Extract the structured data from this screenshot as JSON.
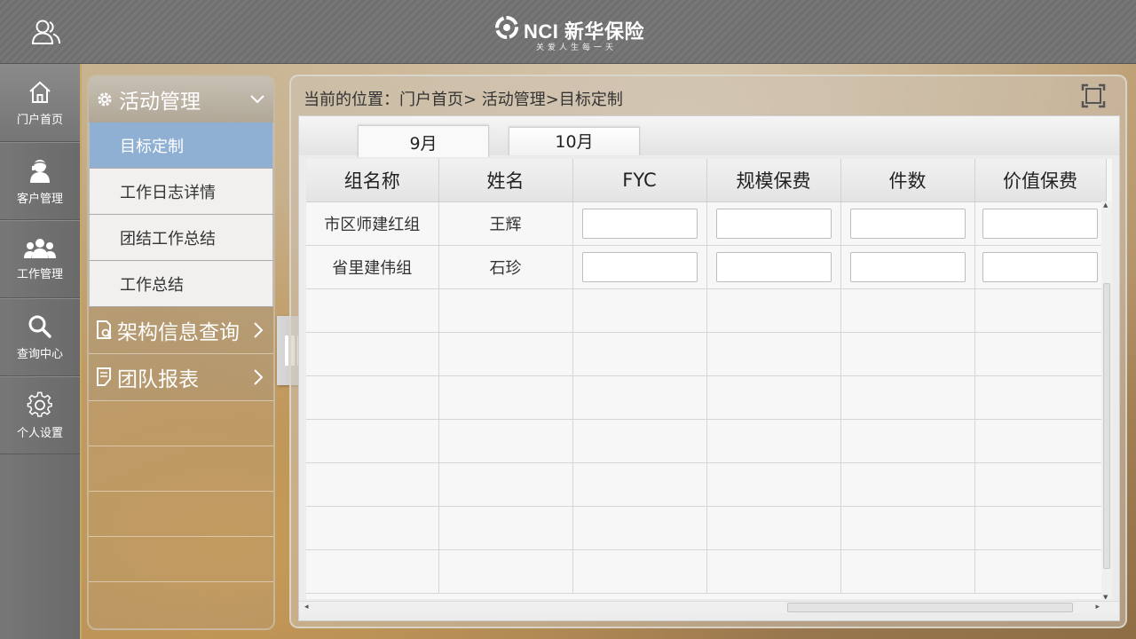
{
  "header": {
    "logo_text": "NCI 新华保险",
    "slogan": "关爱人生每一天"
  },
  "leftnav": {
    "items": [
      {
        "label": "门户首页",
        "icon": "home-icon"
      },
      {
        "label": "客户管理",
        "icon": "customer-icon"
      },
      {
        "label": "工作管理",
        "icon": "team-icon"
      },
      {
        "label": "查询中心",
        "icon": "search-icon"
      },
      {
        "label": "个人设置",
        "icon": "gear-icon"
      }
    ]
  },
  "menu": {
    "header": "活动管理",
    "subitems": [
      "目标定制",
      "工作日志详情",
      "团结工作总结",
      "工作总结"
    ],
    "sections": [
      "架构信息查询",
      "团队报表"
    ]
  },
  "main": {
    "breadcrumb": "当前的位置：门户首页> 活动管理>目标定制",
    "tabs": [
      "9月",
      "10月"
    ],
    "active_tab": "9月",
    "table": {
      "columns": [
        "组名称",
        "姓名",
        "FYC",
        "规模保费",
        "件数",
        "价值保费"
      ],
      "rows": [
        {
          "group": "市区师建红组",
          "name": "王辉"
        },
        {
          "group": "省里建伟组",
          "name": "石珍"
        }
      ]
    }
  },
  "colors": {
    "active_menu": "#8fb0d3",
    "nav_bg": "#6f6f6f",
    "accent_border": "#c9a766"
  }
}
